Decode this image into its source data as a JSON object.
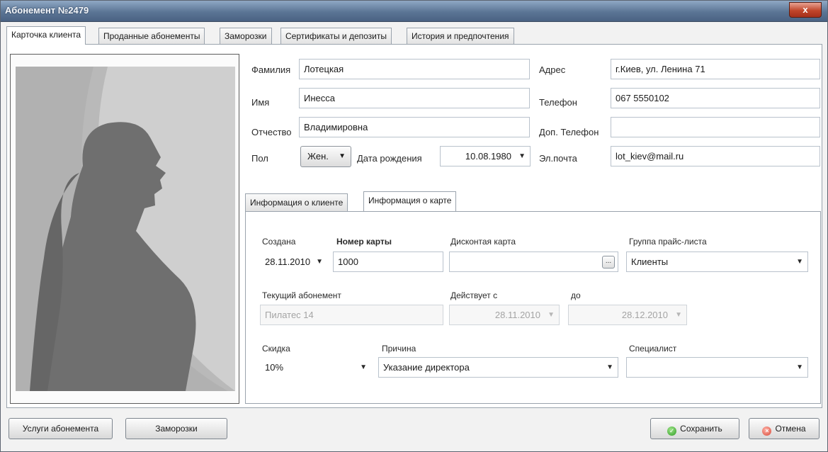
{
  "window": {
    "title": "Абонемент №2479",
    "close_label": "x"
  },
  "tabs": [
    {
      "label": "Карточка клиента"
    },
    {
      "label": "Проданные абонементы"
    },
    {
      "label": "Заморозки"
    },
    {
      "label": "Сертификаты и депозиты"
    },
    {
      "label": "История и предпочтения"
    }
  ],
  "client": {
    "surname_label": "Фамилия",
    "surname": "Лотецкая",
    "name_label": "Имя",
    "name": "Инесса",
    "patronymic_label": "Отчество",
    "patronymic": "Владимировна",
    "gender_label": "Пол",
    "gender": "Жен.",
    "birthdate_label": "Дата рождения",
    "birthdate": "10.08.1980",
    "address_label": "Адрес",
    "address": "г.Киев, ул. Ленина 71",
    "phone_label": "Телефон",
    "phone": "067 5550102",
    "phone2_label": "Доп. Телефон",
    "phone2": "",
    "email_label": "Эл.почта",
    "email": "lot_kiev@mail.ru"
  },
  "inner_tabs": [
    {
      "label": "Информация о клиенте"
    },
    {
      "label": "Информация о карте"
    }
  ],
  "card": {
    "created_label": "Создана",
    "created": "28.11.2010",
    "card_number_label": "Номер карты",
    "card_number": "1000",
    "discount_card_label": "Дисконтая карта",
    "discount_card": "",
    "ellipsis_label": "...",
    "price_group_label": "Группа прайс-листа",
    "price_group": "Клиенты",
    "current_sub_label": "Текущий абонемент",
    "current_sub": "Пилатес 14",
    "valid_from_label": "Действует с",
    "valid_from": "28.11.2010",
    "valid_to_label": "до",
    "valid_to": "28.12.2010",
    "discount_label": "Скидка",
    "discount": "10%",
    "reason_label": "Причина",
    "reason": "Указание директора",
    "specialist_label": "Специалист",
    "specialist": ""
  },
  "buttons": {
    "services": "Услуги абонемента",
    "freezes": "Заморозки",
    "save": "Сохранить",
    "cancel": "Отмена"
  },
  "icons": {
    "dropdown": "chevron-down-icon",
    "save": "check-circle-icon",
    "cancel": "cancel-circle-icon"
  }
}
